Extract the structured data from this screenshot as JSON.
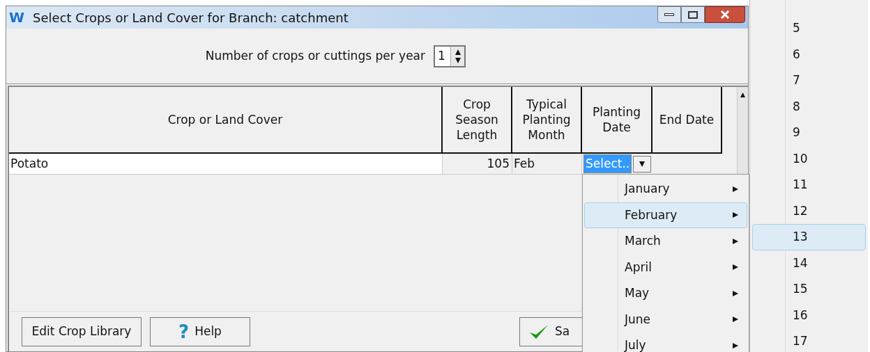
{
  "window": {
    "logo": "W",
    "title": "Select Crops or Land Cover for Branch: catchment"
  },
  "crops_per_year": {
    "label": "Number of crops or cuttings per year",
    "value": "1"
  },
  "table": {
    "columns": [
      "Crop or Land Cover",
      "Crop Season Length",
      "Typical Planting Month",
      "Planting Date",
      "End Date"
    ],
    "rows": [
      {
        "crop": "Potato",
        "season_length": "105",
        "month": "Feb",
        "planting_date": "Select..",
        "end_date": ""
      }
    ]
  },
  "buttons": [
    {
      "label": "Edit Crop Library",
      "kind": "plain"
    },
    {
      "label": "Help",
      "kind": "help",
      "icon": "?"
    },
    {
      "label": "Sa",
      "kind": "save"
    }
  ],
  "month_menu": [
    {
      "label": "January",
      "selected": false
    },
    {
      "label": "February",
      "selected": true
    },
    {
      "label": "March",
      "selected": false
    },
    {
      "label": "April",
      "selected": false
    },
    {
      "label": "May",
      "selected": false
    },
    {
      "label": "June",
      "selected": false
    },
    {
      "label": "July",
      "selected": false
    }
  ],
  "day_menu": [
    {
      "label": "5",
      "selected": false
    },
    {
      "label": "6",
      "selected": false
    },
    {
      "label": "7",
      "selected": false
    },
    {
      "label": "8",
      "selected": false
    },
    {
      "label": "9",
      "selected": false
    },
    {
      "label": "10",
      "selected": false
    },
    {
      "label": "11",
      "selected": false
    },
    {
      "label": "12",
      "selected": false
    },
    {
      "label": "13",
      "selected": true
    },
    {
      "label": "14",
      "selected": false
    },
    {
      "label": "15",
      "selected": false
    },
    {
      "label": "16",
      "selected": false
    },
    {
      "label": "17",
      "selected": false
    }
  ]
}
